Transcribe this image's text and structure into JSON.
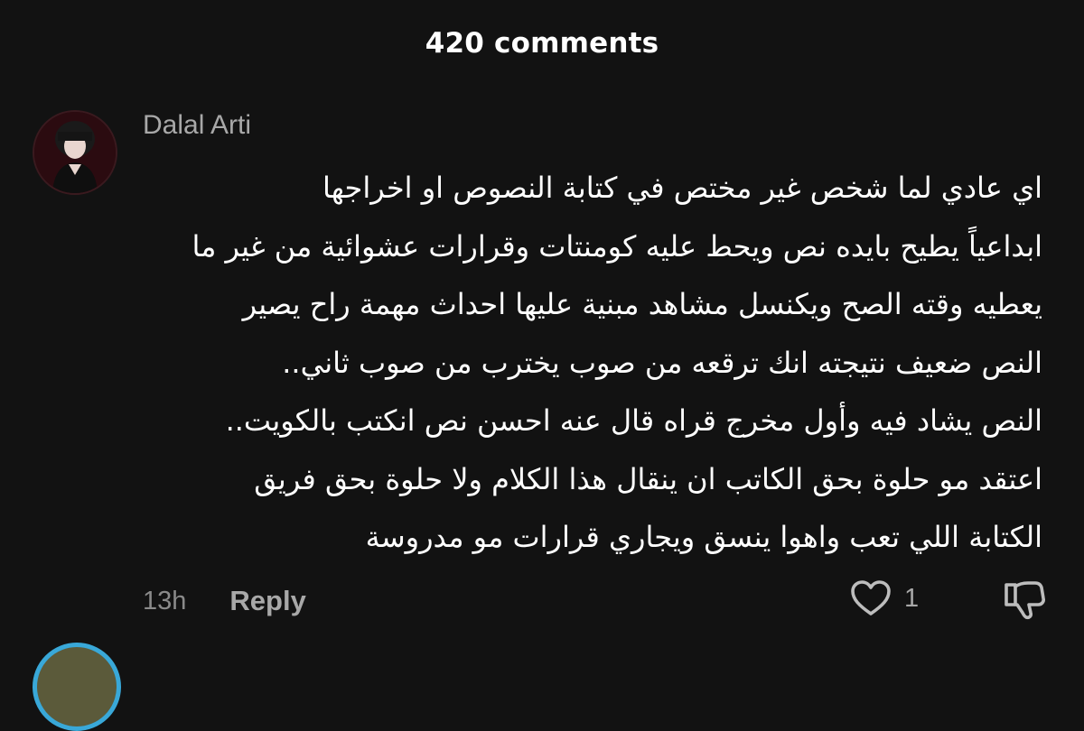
{
  "header": {
    "title": "420 comments"
  },
  "comment": {
    "username": "Dalal Arti",
    "lines": [
      "اي عادي لما شخص غير مختص في كتابة النصوص او اخراجها",
      "ابداعياً يطيح بايده نص ويحط عليه كومنتات وقرارات عشوائية من غير ما",
      "يعطيه وقته الصح ويكنسل مشاهد مبنية عليها احداث مهمة راح يصير",
      "النص ضعيف نتيجته انك ترقعه من صوب يخترب من صوب ثاني..",
      "النص يشاد فيه وأول مخرج قراه قال عنه احسن نص انكتب بالكويت..",
      "اعتقد مو حلوة بحق الكاتب ان ينقال هذا الكلام ولا حلوة بحق فريق",
      "الكتابة اللي تعب واهوا ينسق ويجاري قرارات مو مدروسة"
    ],
    "time": "13h",
    "reply_label": "Reply",
    "like_count": "1",
    "icons": {
      "like": "heart-icon",
      "dislike": "thumbs-down-icon"
    }
  },
  "colors": {
    "background": "#121212",
    "primary_text": "#ffffff",
    "secondary_text": "#a8a8a8",
    "accent_ring": "#39a8d8"
  }
}
